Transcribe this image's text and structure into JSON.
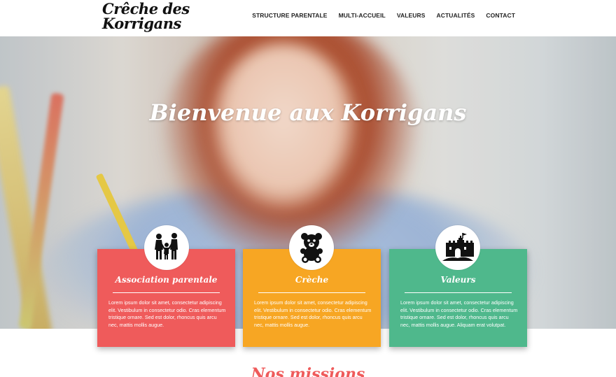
{
  "header": {
    "logo_line1": "Crêche des",
    "logo_line2": "Korrigans",
    "nav": [
      "STRUCTURE PARENTALE",
      "MULTI-ACCUEIL",
      "VALEURS",
      "ACTUALITÉS",
      "CONTACT"
    ]
  },
  "hero": {
    "title": "Bienvenue aux Korrigans"
  },
  "cards": [
    {
      "title": "Association parentale",
      "icon": "family-icon",
      "color": "#ef5b5b",
      "text": "Lorem ipsum dolor sit amet, consectetur adipiscing elit. Vestibulum in consectetur odio. Cras elementum tristique ornare. Sed est dolor, rhoncus quis arcu nec, mattis mollis augue."
    },
    {
      "title": "Crèche",
      "icon": "teddy-bear-icon",
      "color": "#f7a623",
      "text": "Lorem ipsum dolor sit amet, consectetur adipiscing elit. Vestibulum in consectetur odio. Cras elementum tristique ornare. Sed est dolor, rhoncus quis arcu nec, mattis mollis augue."
    },
    {
      "title": "Valeurs",
      "icon": "castle-icon",
      "color": "#4fb88c",
      "text": "Lorem ipsum dolor sit amet, consectetur adipiscing elit. Vestibulum in consectetur odio. Cras elementum tristique ornare. Sed est dolor, rhoncus quis arcu nec, mattis mollis augue. Aliquam erat volutpat."
    }
  ],
  "missions": {
    "title": "Nos missions"
  }
}
